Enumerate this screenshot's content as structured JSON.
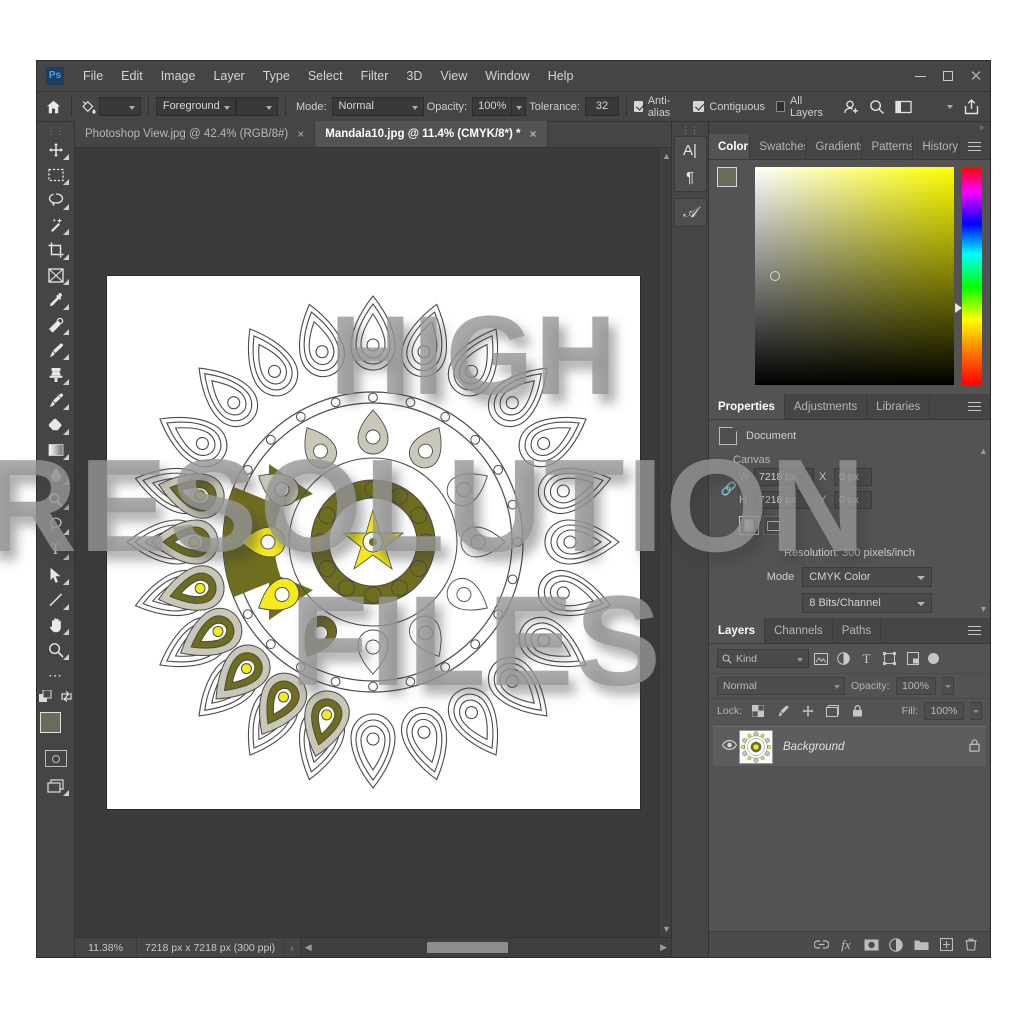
{
  "app": {
    "logo_text": "Ps",
    "menus": [
      "File",
      "Edit",
      "Image",
      "Layer",
      "Type",
      "Select",
      "Filter",
      "3D",
      "View",
      "Window",
      "Help"
    ],
    "window_controls": {
      "minimize": "minimize-button",
      "maximize": "maximize-button",
      "close": "close-button"
    }
  },
  "options_bar": {
    "home_icon": "home-icon",
    "tool_icon": "paint-bucket-icon",
    "fill_source": "Foreground",
    "mode_label": "Mode:",
    "mode_value": "Normal",
    "opacity_label": "Opacity:",
    "opacity_value": "100%",
    "tolerance_label": "Tolerance:",
    "tolerance_value": "32",
    "anti_alias_label": "Anti-alias",
    "anti_alias_checked": true,
    "contiguous_label": "Contiguous",
    "contiguous_checked": true,
    "all_layers_label": "All Layers",
    "all_layers_checked": false,
    "right_icons": [
      "add-user-icon",
      "search-icon",
      "workspace-icon",
      "share-icon"
    ]
  },
  "tools": [
    {
      "name": "move-tool",
      "glyph": "✛"
    },
    {
      "name": "rectangular-marquee-tool",
      "glyph": "⬚"
    },
    {
      "name": "lasso-tool",
      "glyph": "◌"
    },
    {
      "name": "magic-wand-tool",
      "glyph": "✨"
    },
    {
      "name": "crop-tool",
      "glyph": "⌜"
    },
    {
      "name": "frame-tool",
      "glyph": "⛋"
    },
    {
      "name": "eyedropper-tool",
      "glyph": "✐"
    },
    {
      "name": "spot-healing-brush-tool",
      "glyph": "⊕"
    },
    {
      "name": "brush-tool",
      "glyph": "✒"
    },
    {
      "name": "clone-stamp-tool",
      "glyph": "☗"
    },
    {
      "name": "history-brush-tool",
      "glyph": "✎"
    },
    {
      "name": "eraser-tool",
      "glyph": "▱"
    },
    {
      "name": "gradient-tool",
      "glyph": "▤"
    },
    {
      "name": "blur-tool",
      "glyph": "●"
    },
    {
      "name": "dodge-tool",
      "glyph": "◔"
    },
    {
      "name": "pen-tool",
      "glyph": "✑"
    },
    {
      "name": "type-tool",
      "glyph": "T"
    },
    {
      "name": "path-selection-tool",
      "glyph": "➤"
    },
    {
      "name": "line-tool",
      "glyph": "╱"
    },
    {
      "name": "hand-tool",
      "glyph": "✋"
    },
    {
      "name": "zoom-tool",
      "glyph": "⚲"
    },
    {
      "name": "edit-toolbar-button",
      "glyph": "⋯"
    }
  ],
  "tool_footer": {
    "foreground_color": "#6b6b5a",
    "background_color": "#ddd6c4",
    "quick_mask_icon": "quick-mask-icon",
    "screen_mode_icon": "screen-mode-icon",
    "swap_icon": "swap-colors-icon",
    "default_icon": "default-colors-icon"
  },
  "document_tabs": [
    {
      "label": "Photoshop View.jpg @ 42.4% (RGB/8#)",
      "active": false,
      "close": "×"
    },
    {
      "label": "Mandala10.jpg @ 11.4% (CMYK/8*) *",
      "active": true,
      "close": "×"
    }
  ],
  "status_bar": {
    "zoom": "11.38%",
    "doc_info": "7218 px x 7218 px (300 ppi)",
    "caret_right": "›",
    "caret_left": "‹"
  },
  "right_rail": {
    "character_icon": "character-panel-icon",
    "character_glyph": "A|",
    "paragraph_icon": "paragraph-panel-icon",
    "paragraph_glyph": "¶",
    "glyphs_icon": "glyphs-panel-icon",
    "glyphs_glyph": "𝒜"
  },
  "color_panel": {
    "tabs": [
      {
        "label": "Color",
        "active": true
      },
      {
        "label": "Swatches",
        "active": false
      },
      {
        "label": "Gradients",
        "active": false
      },
      {
        "label": "Patterns",
        "active": false
      },
      {
        "label": "History",
        "active": false
      }
    ],
    "foreground_color": "#6b6b5a",
    "background_color": "#ddd6c4",
    "picker_hue": "#ffff00",
    "menu_icon": "panel-menu-icon"
  },
  "properties_panel": {
    "tabs": [
      {
        "label": "Properties",
        "active": true
      },
      {
        "label": "Adjustments",
        "active": false
      },
      {
        "label": "Libraries",
        "active": false
      }
    ],
    "doc_row_label": "Document",
    "section_label": "Canvas",
    "width_label": "W",
    "width_value": "7218 px",
    "height_label": "H",
    "height_value": "7218 px",
    "x_label": "X",
    "x_value": "0 px",
    "y_label": "Y",
    "y_value": "0 px",
    "link_icon": "link-dimensions-icon",
    "resolution_text": "Resolution: 300 pixels/inch",
    "mode_label": "Mode",
    "mode_value": "CMYK Color",
    "depth_value": "8 Bits/Channel",
    "menu_icon": "panel-menu-icon"
  },
  "layers_panel": {
    "tabs": [
      {
        "label": "Layers",
        "active": true
      },
      {
        "label": "Channels",
        "active": false
      },
      {
        "label": "Paths",
        "active": false
      }
    ],
    "filter_placeholder": "Kind",
    "filter_icons": [
      "filter-pixel-icon",
      "filter-adjustment-icon",
      "filter-type-icon",
      "filter-shape-icon",
      "filter-smart-object-icon"
    ],
    "blend_mode": "Normal",
    "opacity_label": "Opacity:",
    "opacity_value": "100%",
    "lock_label": "Lock:",
    "lock_icons": [
      "lock-transparent-icon",
      "lock-image-icon",
      "lock-position-icon",
      "lock-artboard-icon",
      "lock-all-icon"
    ],
    "fill_label": "Fill:",
    "fill_value": "100%",
    "layers": [
      {
        "name": "Background",
        "visible": true,
        "locked": true,
        "eye_icon": "eye-icon",
        "lock_icon": "lock-icon"
      }
    ],
    "footer_icons": [
      "link-layers-icon",
      "layer-styles-icon",
      "layer-mask-icon",
      "adjustment-layer-icon",
      "new-group-icon",
      "new-layer-icon",
      "delete-layer-icon"
    ],
    "menu_icon": "panel-menu-icon"
  },
  "watermark": {
    "line1": "HIGH",
    "line2": "RESOLUTION",
    "line3": "FILES",
    "color": "#969696"
  },
  "artwork": {
    "title": "Mandala10.jpg",
    "palette": {
      "olive": "#6f6d1e",
      "olive_dark": "#5f5d19",
      "yellow": "#f5ea1c",
      "sage": "#c9c8b8",
      "outline": "#4a4a4a",
      "paper": "#ffffff"
    }
  }
}
